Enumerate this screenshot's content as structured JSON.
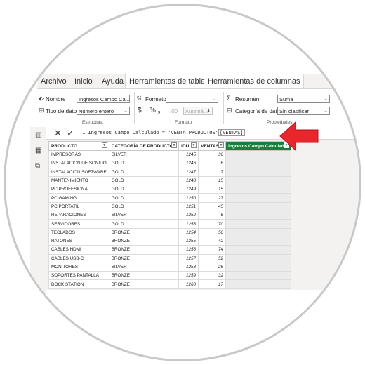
{
  "menu": {
    "tabs": [
      "Archivo",
      "Inicio",
      "Ayuda",
      "Herramientas de tablas",
      "Herramientas de columnas"
    ],
    "active_tab": "Herramientas de columnas"
  },
  "ribbon": {
    "nombre_label": "Nombre",
    "nombre_value": "Ingresos Campo Ca...",
    "tipo_label": "Tipo de datos",
    "tipo_value": "Número entero",
    "estructura_label": "Estructura",
    "formato_label": "Formato",
    "formato_value": "",
    "currency_symbols": "$ ~ % ❟",
    "decimal_sep": ".00",
    "auto_value": "Automá...",
    "formato_group_label": "Formato",
    "resumen_label": "Resumen",
    "resumen_value": "Suma",
    "categoria_label": "Categoría de datos",
    "categoria_value": "Sin clasificar",
    "propiedades_label": "Propiedades"
  },
  "formula_bar": {
    "line": "1",
    "text_before": "Ingresos Campo Calculado = 'VENTA PRODUCTOS'",
    "highlight": "[VENTAS]"
  },
  "table": {
    "columns": [
      "PRODUCTO",
      "CATEGORÍA DE PRODUCTOS",
      "IDU",
      "VENTAS",
      "Ingresos Campo Calculado"
    ],
    "rows": [
      [
        "IMPRESORAS",
        "SILVER",
        "1245",
        "36"
      ],
      [
        "INSTALACION DE SONIDO",
        "GOLD",
        "1246",
        "6"
      ],
      [
        "INSTALACION SOFTWARE",
        "GOLD",
        "1247",
        "7"
      ],
      [
        "MANTENIMIENTO",
        "GOLD",
        "1248",
        "15"
      ],
      [
        "PC PROFESIONAL",
        "GOLD",
        "1249",
        "15"
      ],
      [
        "PC GAMING",
        "GOLD",
        "1250",
        "27"
      ],
      [
        "PC PORTATIL",
        "GOLD",
        "1251",
        "45"
      ],
      [
        "REPARACIONES",
        "SILVER",
        "1252",
        "6"
      ],
      [
        "SERVIDORES",
        "GOLD",
        "1253",
        "70"
      ],
      [
        "TECLADOS",
        "BRONZE",
        "1254",
        "50"
      ],
      [
        "RATONES",
        "BRONZE",
        "1255",
        "42"
      ],
      [
        "CABLES HDMI",
        "BRONZE",
        "1256",
        "74"
      ],
      [
        "CABLES USB-C",
        "BRONZE",
        "1257",
        "52"
      ],
      [
        "MONITORES",
        "SILVER",
        "1258",
        "25"
      ],
      [
        "SOPORTES PANTALLA",
        "BRONZE",
        "1259",
        "32"
      ],
      [
        "DOCK STATION",
        "BRONZE",
        "1260",
        "17"
      ]
    ]
  },
  "icons": {
    "nombre": "tag-icon",
    "tipo": "data-type-icon",
    "formato": "format-icon",
    "resumen": "sigma-icon",
    "categoria": "category-icon",
    "cancel": "close-icon",
    "confirm": "check-icon",
    "report_view": "report-view-icon",
    "data_view": "table-view-icon",
    "model_view": "model-view-icon"
  },
  "colors": {
    "accent": "#1b7e3b",
    "arrow": "#e8262b"
  }
}
